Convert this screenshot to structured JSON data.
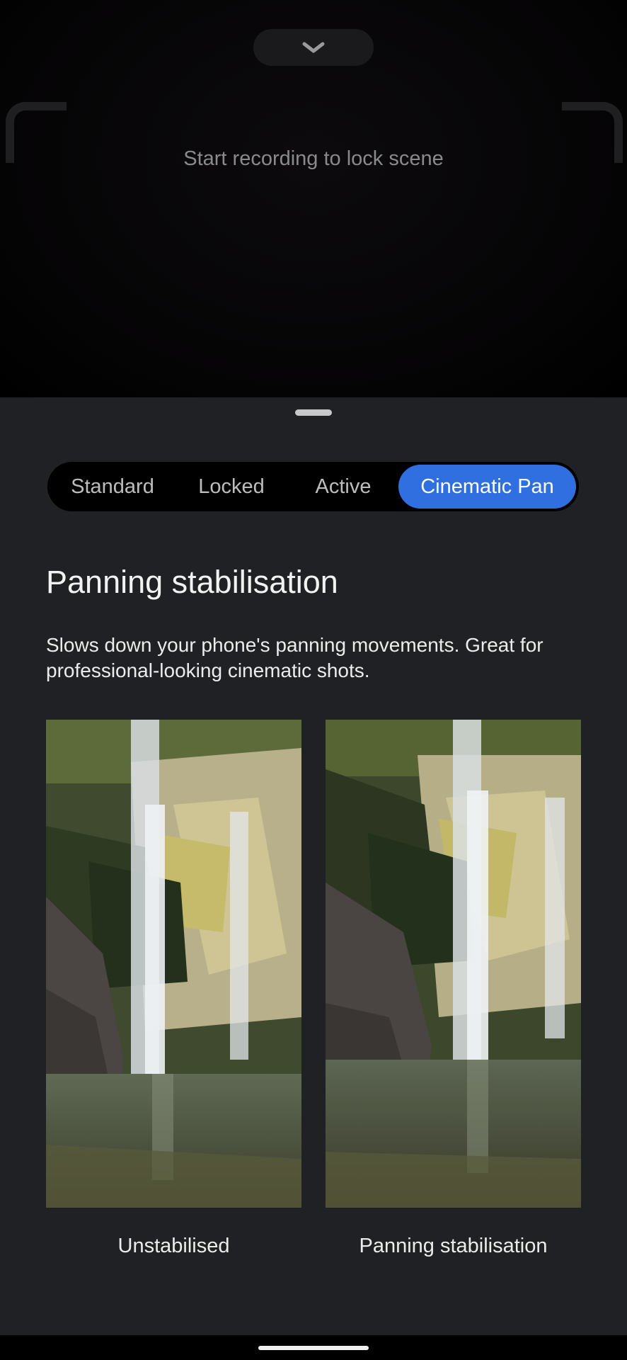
{
  "viewfinder": {
    "status_text": "Start recording to lock scene",
    "collapse_icon": "chevron-down-icon"
  },
  "stabilisation": {
    "modes": [
      "Standard",
      "Locked",
      "Active",
      "Cinematic Pan"
    ],
    "selected": "Cinematic Pan",
    "accent_color": "#2f6fe0"
  },
  "info": {
    "title": "Panning stabilisation",
    "description": "Slows down your phone's panning movements. Great for professional-looking cinematic shots."
  },
  "comparison": {
    "left_caption": "Unstabilised",
    "right_caption": "Panning stabilisation"
  }
}
